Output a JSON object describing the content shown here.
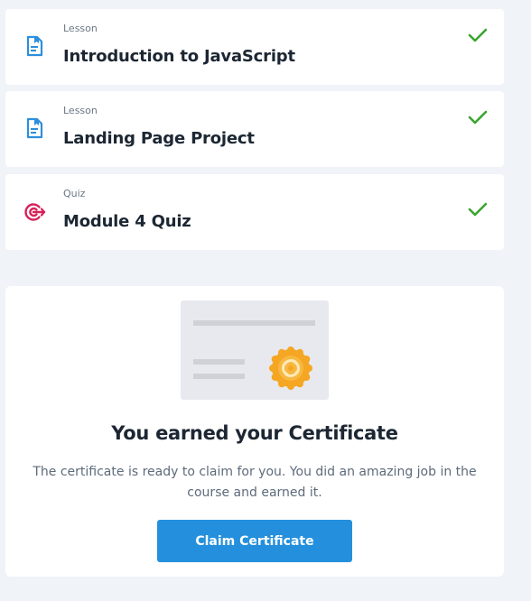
{
  "items": [
    {
      "type": "Lesson",
      "title": "Introduction to JavaScript",
      "icon": "lesson-document-icon",
      "status": "completed"
    },
    {
      "type": "Lesson",
      "title": "Landing Page Project",
      "icon": "lesson-document-icon",
      "status": "completed"
    },
    {
      "type": "Quiz",
      "title": "Module 4 Quiz",
      "icon": "quiz-target-icon",
      "status": "completed"
    }
  ],
  "certificate": {
    "title": "You earned your Certificate",
    "description": "The certificate is ready to claim for you. You did an amazing job in the course and earned it.",
    "button_label": "Claim Certificate"
  },
  "colors": {
    "lesson_icon": "#2d8fdc",
    "quiz_icon": "#d6225a",
    "check": "#3aa52f",
    "button": "#2490dd",
    "seal": "#f5a623"
  }
}
